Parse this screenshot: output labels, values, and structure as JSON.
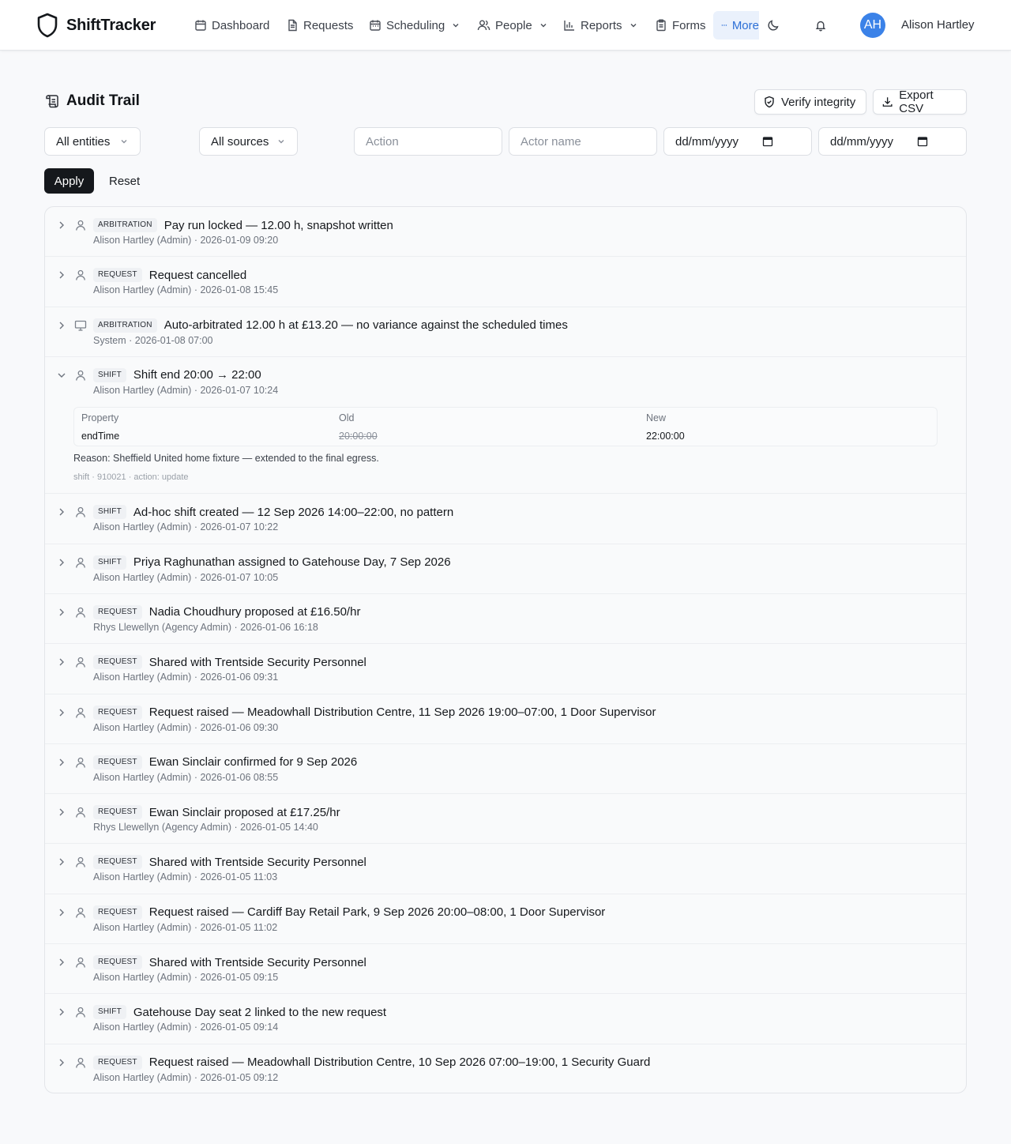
{
  "app": {
    "name": "ShiftTracker"
  },
  "nav": {
    "items": [
      {
        "label": "Dashboard"
      },
      {
        "label": "Requests"
      },
      {
        "label": "Scheduling"
      },
      {
        "label": "People"
      },
      {
        "label": "Reports"
      },
      {
        "label": "Forms"
      }
    ],
    "more_label": "More",
    "user": {
      "initials": "AH",
      "name": "Alison Hartley"
    }
  },
  "header": {
    "title": "Audit Trail",
    "verify_label": "Verify integrity",
    "export_label": "Export CSV"
  },
  "filters": {
    "entity_selected": "All entities",
    "source_selected": "All sources",
    "action_placeholder": "Action",
    "actor_placeholder": "Actor name",
    "date_from_placeholder": "dd/mm/yyyy",
    "date_to_placeholder": "dd/mm/yyyy",
    "apply_label": "Apply",
    "reset_label": "Reset"
  },
  "entries": [
    {
      "type": "ARBITRATION",
      "summary": "Pay run locked — 12.00 h, snapshot written",
      "meta": "Alison Hartley (Admin) · 2026-01-09 09:20",
      "actor_icon": "user-icon"
    },
    {
      "type": "REQUEST",
      "summary": "Request cancelled",
      "meta": "Alison Hartley (Admin) · 2026-01-08 15:45",
      "actor_icon": "user-icon"
    },
    {
      "type": "ARBITRATION",
      "summary": "Auto-arbitrated 12.00 h at £13.20 — no variance against the scheduled times",
      "meta": "System · 2026-01-08 07:00",
      "actor_icon": "monitor-icon"
    },
    {
      "type": "SHIFT",
      "summary": "Shift end 20:00 → 22:00",
      "meta": "Alison Hartley (Admin) · 2026-01-07 10:24",
      "actor_icon": "user-icon",
      "expanded": true,
      "detail": {
        "headers": {
          "property": "Property",
          "old": "Old",
          "new": "New"
        },
        "row": {
          "property": "endTime",
          "old": "20:00:00",
          "new": "22:00:00"
        },
        "reason": "Reason: Sheffield United home fixture — extended to the final egress.",
        "ref": "shift · 910021 · action: update"
      }
    },
    {
      "type": "SHIFT",
      "summary": "Ad-hoc shift created — 12 Sep 2026 14:00–22:00, no pattern",
      "meta": "Alison Hartley (Admin) · 2026-01-07 10:22",
      "actor_icon": "user-icon"
    },
    {
      "type": "SHIFT",
      "summary": "Priya Raghunathan assigned to Gatehouse Day, 7 Sep 2026",
      "meta": "Alison Hartley (Admin) · 2026-01-07 10:05",
      "actor_icon": "user-icon"
    },
    {
      "type": "REQUEST",
      "summary": "Nadia Choudhury proposed at £16.50/hr",
      "meta": "Rhys Llewellyn (Agency Admin) · 2026-01-06 16:18",
      "actor_icon": "user-icon"
    },
    {
      "type": "REQUEST",
      "summary": "Shared with Trentside Security Personnel",
      "meta": "Alison Hartley (Admin) · 2026-01-06 09:31",
      "actor_icon": "user-icon"
    },
    {
      "type": "REQUEST",
      "summary": "Request raised — Meadowhall Distribution Centre, 11 Sep 2026 19:00–07:00, 1 Door Supervisor",
      "meta": "Alison Hartley (Admin) · 2026-01-06 09:30",
      "actor_icon": "user-icon"
    },
    {
      "type": "REQUEST",
      "summary": "Ewan Sinclair confirmed for 9 Sep 2026",
      "meta": "Alison Hartley (Admin) · 2026-01-06 08:55",
      "actor_icon": "user-icon"
    },
    {
      "type": "REQUEST",
      "summary": "Ewan Sinclair proposed at £17.25/hr",
      "meta": "Rhys Llewellyn (Agency Admin) · 2026-01-05 14:40",
      "actor_icon": "user-icon"
    },
    {
      "type": "REQUEST",
      "summary": "Shared with Trentside Security Personnel",
      "meta": "Alison Hartley (Admin) · 2026-01-05 11:03",
      "actor_icon": "user-icon"
    },
    {
      "type": "REQUEST",
      "summary": "Request raised — Cardiff Bay Retail Park, 9 Sep 2026 20:00–08:00, 1 Door Supervisor",
      "meta": "Alison Hartley (Admin) · 2026-01-05 11:02",
      "actor_icon": "user-icon"
    },
    {
      "type": "REQUEST",
      "summary": "Shared with Trentside Security Personnel",
      "meta": "Alison Hartley (Admin) · 2026-01-05 09:15",
      "actor_icon": "user-icon"
    },
    {
      "type": "SHIFT",
      "summary": "Gatehouse Day seat 2 linked to the new request",
      "meta": "Alison Hartley (Admin) · 2026-01-05 09:14",
      "actor_icon": "user-icon"
    },
    {
      "type": "REQUEST",
      "summary": "Request raised — Meadowhall Distribution Centre, 10 Sep 2026 07:00–19:00, 1 Security Guard",
      "meta": "Alison Hartley (Admin) · 2026-01-05 09:12",
      "actor_icon": "user-icon"
    }
  ]
}
